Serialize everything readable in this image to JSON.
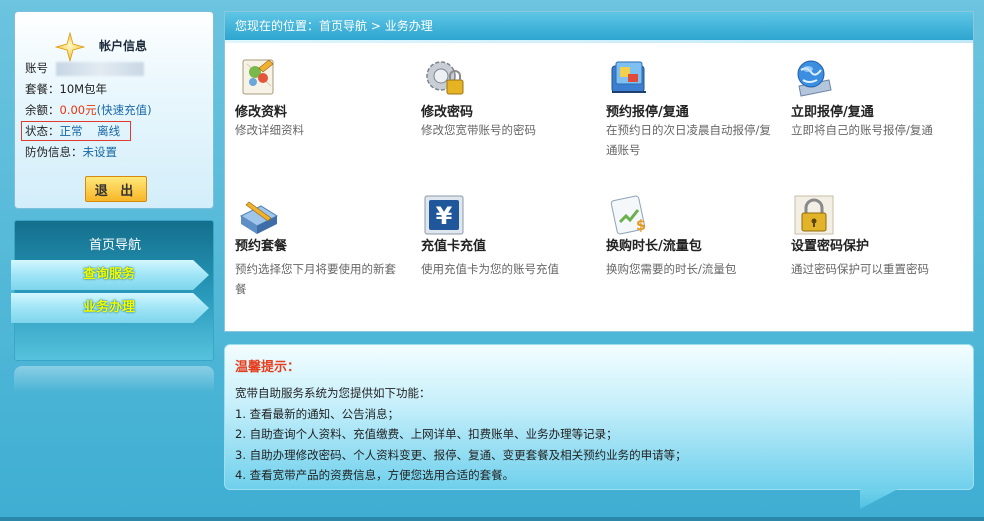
{
  "account": {
    "title": "帐户信息",
    "account_label": "账号",
    "plan_label": "套餐：",
    "plan_value": "10M包年",
    "balance_label": "余额：",
    "balance_value": "0.00元",
    "recharge_link": "(快速充值)",
    "status_label": "状态：",
    "status_value": "正常",
    "online_value": "离线",
    "anti_fraud_label": "防伪信息：",
    "anti_fraud_value": "未设置",
    "exit_label": "退 出"
  },
  "nav": {
    "title": "首页导航",
    "items": [
      {
        "label": "查询服务"
      },
      {
        "label": "业务办理"
      }
    ]
  },
  "breadcrumb": {
    "prefix": "您现在的位置：",
    "home": "首页导航",
    "separator": " > ",
    "current": "业务办理"
  },
  "services": [
    {
      "title": "修改资料",
      "desc": "修改详细资料",
      "icon": "edit-profile-icon"
    },
    {
      "title": "修改密码",
      "desc": "修改您宽带账号的密码",
      "icon": "gear-lock-icon"
    },
    {
      "title": "预约报停/复通",
      "desc": "在预约日的次日凌晨自动报停/复通账号",
      "icon": "calendar-book-icon"
    },
    {
      "title": "立即报停/复通",
      "desc": "立即将自己的账号报停/复通",
      "icon": "globe-book-icon"
    },
    {
      "title": "预约套餐",
      "desc": "预约选择您下月将要使用的新套餐",
      "icon": "package-pen-icon"
    },
    {
      "title": "充值卡充值",
      "desc": "使用充值卡为您的账号充值",
      "icon": "yen-card-icon"
    },
    {
      "title": "换购时长/流量包",
      "desc": "换购您需要的时长/流量包",
      "icon": "dollar-card-icon"
    },
    {
      "title": "设置密码保护",
      "desc": "通过密码保护可以重置密码",
      "icon": "padlock-icon"
    }
  ],
  "tips": {
    "title": "温馨提示：",
    "intro": "宽带自助服务系统为您提供如下功能：",
    "lines": [
      "1. 查看最新的通知、公告消息；",
      "2. 自助查询个人资料、充值缴费、上网详单、扣费账单、业务办理等记录；",
      "3. 自助办理修改密码、个人资料变更、报停、复通、变更套餐及相关预约业务的申请等；",
      "4. 查看宽带产品的资费信息，方便您选用合适的套餐。"
    ]
  },
  "colors": {
    "accent_red": "#e8340c",
    "link_blue": "#1667a8",
    "nav_text_yellow": "#f3ff00",
    "header_blue": "#2da5cf"
  }
}
